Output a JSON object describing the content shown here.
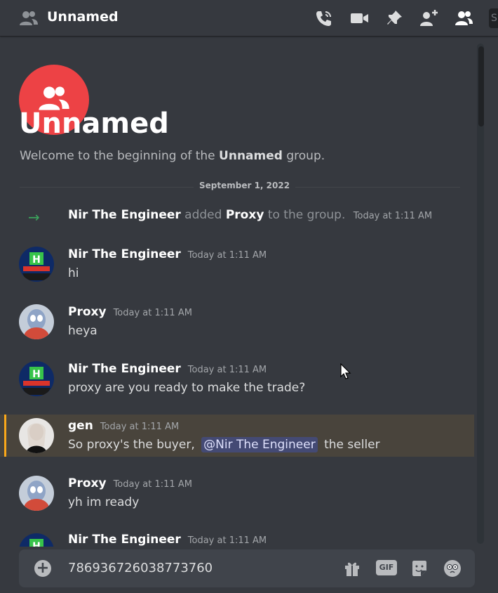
{
  "header": {
    "title": "Unnamed",
    "icons": [
      "group-icon",
      "call-icon",
      "video-icon",
      "pin-icon",
      "add-friend-icon",
      "member-list-icon"
    ],
    "search_stub": "S"
  },
  "welcome": {
    "title": "Unnamed",
    "subtitle_prefix": "Welcome to the beginning of the ",
    "subtitle_name": "Unnamed",
    "subtitle_suffix": " group."
  },
  "date_divider": "September 1, 2022",
  "system_message": {
    "actor": "Nir The Engineer",
    "action": "added",
    "target": "Proxy",
    "suffix": "to the group.",
    "timestamp": "Today at 1:11 AM"
  },
  "messages": [
    {
      "author": "Nir The Engineer",
      "timestamp": "Today at 1:11 AM",
      "text": "hi"
    },
    {
      "author": "Proxy",
      "timestamp": "Today at 1:11 AM",
      "text": "heya"
    },
    {
      "author": "Nir The Engineer",
      "timestamp": "Today at 1:11 AM",
      "text": "proxy are you ready to make the trade?"
    },
    {
      "author": "gen",
      "timestamp": "Today at 1:11 AM",
      "text_before": "So proxy's the buyer, ",
      "mention": "@Nir The Engineer",
      "text_after": "the seller"
    },
    {
      "author": "Proxy",
      "timestamp": "Today at 1:11 AM",
      "text": "yh im ready"
    },
    {
      "author": "Nir The Engineer",
      "timestamp": "Today at 1:11 AM",
      "text": ""
    }
  ],
  "composer": {
    "value": "786936726038773760",
    "gif_label": "GIF",
    "icons": [
      "add-attachment-icon",
      "gift-icon",
      "gif-icon",
      "sticker-icon",
      "emoji-icon"
    ]
  },
  "colors": {
    "background": "#36393f",
    "group_avatar": "#ed4245",
    "mention_highlight": "#49443c",
    "mention_bar": "#faa81a",
    "system_arrow": "#3ba55c"
  }
}
